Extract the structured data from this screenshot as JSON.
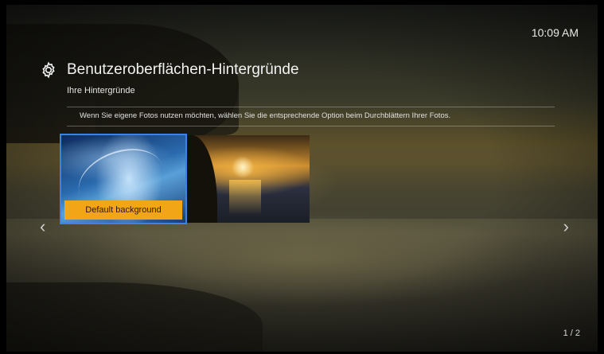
{
  "clock": "10:09 AM",
  "header": {
    "title": "Benutzeroberflächen-Hintergründe",
    "subtitle": "Ihre Hintergründe",
    "icon": "gear-icon"
  },
  "hint": "Wenn Sie eigene Fotos nutzen möchten, wählen Sie die entsprechende Option beim Durchblättern Ihrer Fotos.",
  "backgrounds": [
    {
      "label": "Default background",
      "selected": true
    },
    {
      "label": "",
      "selected": false
    }
  ],
  "colors": {
    "selection": "#3f82e6",
    "label_bg": "#f2a516"
  },
  "nav": {
    "prev": "‹",
    "next": "›"
  },
  "pagination": "1 / 2"
}
